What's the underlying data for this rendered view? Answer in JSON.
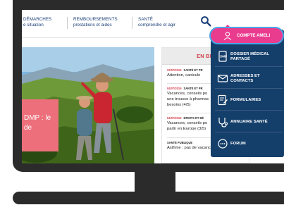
{
  "nav": {
    "items": [
      {
        "title": "DÉMARCHES",
        "subtitle": "e situation"
      },
      {
        "title": "REMBOURSEMENTS",
        "subtitle": "prestations et aides"
      },
      {
        "title": "SANTÉ",
        "subtitle": "comprendre et agir"
      }
    ]
  },
  "hero": {
    "text": "DMP : le\nde"
  },
  "news": {
    "title": "EN BR",
    "items": [
      {
        "date": "22/07/2019",
        "category": "SANTÉ ET PR",
        "text": "Attention, canicule"
      },
      {
        "date": "04/07/2019",
        "category": "SANTÉ ET PR",
        "text": "Vacances, conseils po\nune trousse à pharmac\nbesoins (4/5)"
      },
      {
        "date": "04/07/2019",
        "category": "DROITS ET DÉ",
        "text": "Vacances, conseils po\npartir en Europe (3/5)"
      },
      {
        "date": "",
        "category": "SANTÉ PUBLIQUE",
        "text": "Asthme : pas de vacances pour le"
      }
    ]
  },
  "dropdown": {
    "active_label": "COMPTE AMELI",
    "items": [
      {
        "label": "DOSSIER MÉDICAL\nPARTAGÉ",
        "icon": "dmp-icon"
      },
      {
        "label": "ADRESSES ET\nCONTACTS",
        "icon": "envelope-icon"
      },
      {
        "label": "FORMULAIRES",
        "icon": "form-icon"
      },
      {
        "label": "ANNUAIRE SANTÉ",
        "icon": "stethoscope-icon"
      },
      {
        "label": "FORUM",
        "icon": "chat-icon"
      }
    ]
  },
  "colors": {
    "navy": "#153f6b",
    "pink": "#ea3c8f",
    "blue_outline": "#48a4e7",
    "coral": "#ec6f7b",
    "red": "#d23c4b"
  }
}
